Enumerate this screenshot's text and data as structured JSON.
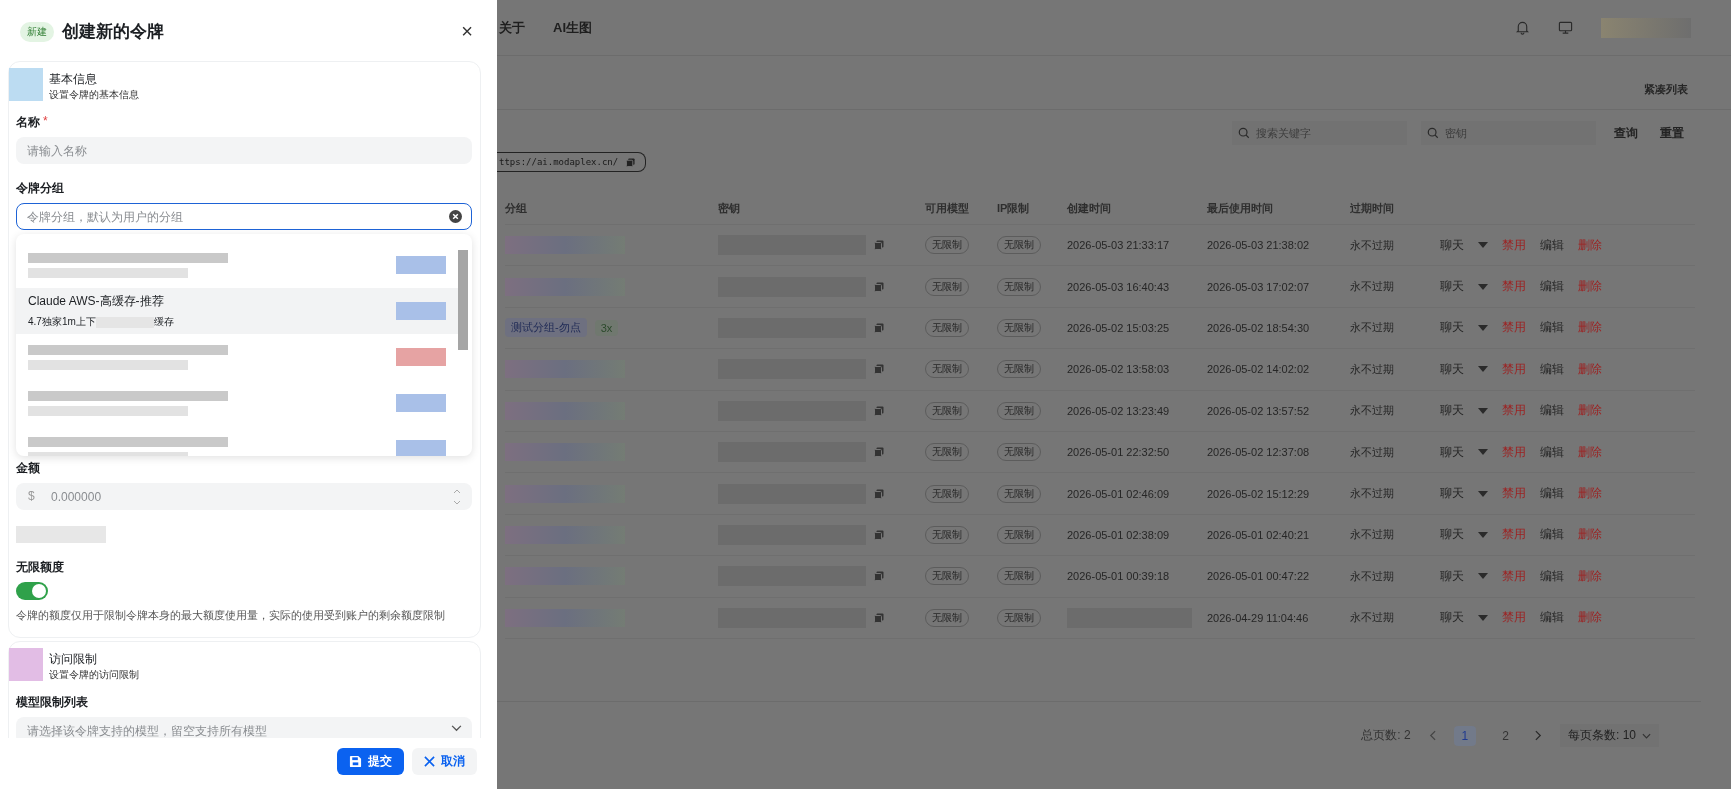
{
  "drawer": {
    "badge": "新建",
    "title": "创建新的令牌",
    "close": "×",
    "sections": [
      {
        "title": "基本信息",
        "subtitle": "设置令牌的基本信息",
        "color": "#bcdcf2"
      },
      {
        "title": "访问限制",
        "subtitle": "设置令牌的访问限制",
        "color": "#e2bde5"
      }
    ],
    "name_field": {
      "label": "名称",
      "required": "*",
      "placeholder": "请输入名称"
    },
    "group_field": {
      "label": "令牌分组",
      "placeholder": "令牌分组，默认为用户的分组",
      "focused": true
    },
    "group_options": [
      {
        "highlighted": false,
        "color": "#a9c0e8"
      },
      {
        "label": "Claude AWS-高缓存-推荐",
        "description_start": "4.7独家1m上下",
        "description_end": "缓存",
        "highlighted": true,
        "color": "#a9c0e8"
      },
      {
        "highlighted": false,
        "color": "#e6a3a3"
      },
      {
        "highlighted": false,
        "color": "#a9c0e8"
      },
      {
        "highlighted": false,
        "color": "#a9c0e8"
      }
    ],
    "amount_field": {
      "label": "金额",
      "prefix": "$",
      "placeholder": "0.000000"
    },
    "unlimited": {
      "label": "无限额度",
      "on": true,
      "help": "令牌的额度仅用于限制令牌本身的最大额度使用量，实际的使用受到账户的剩余额度限制"
    },
    "model_field": {
      "label": "模型限制列表",
      "placeholder": "请选择该令牌支持的模型，留空支持所有模型"
    },
    "buttons": [
      {
        "label": "提交",
        "kind": "primary"
      },
      {
        "label": "取消",
        "kind": "cancel"
      }
    ]
  },
  "page": {
    "nav": [
      "关于",
      "AI生图"
    ],
    "compact_toggle": "紧凑列表",
    "search": [
      {
        "placeholder": "搜索关键字"
      },
      {
        "placeholder": "密钥"
      }
    ],
    "actions": [
      "查询",
      "重置"
    ],
    "base_url": "ttps://ai.modaplex.cn/",
    "table": {
      "columns": [
        "分组",
        "密钥",
        "可用模型",
        "IP限制",
        "创建时间",
        "最后使用时间",
        "过期时间"
      ],
      "rows": [
        {
          "group": null,
          "models": "无限制",
          "ip": "无限制",
          "created": "2026-05-03 21:33:17",
          "last_used": "2026-05-03 21:38:02",
          "expires": "永不过期",
          "chat": "聊天",
          "disable": "禁用",
          "edit": "编辑",
          "delete": "删除"
        },
        {
          "group": null,
          "models": "无限制",
          "ip": "无限制",
          "created": "2026-05-03 16:40:43",
          "last_used": "2026-05-03 17:02:07",
          "expires": "永不过期",
          "chat": "聊天",
          "disable": "禁用",
          "edit": "编辑",
          "delete": "删除"
        },
        {
          "group": {
            "name": "测试分组-勿点",
            "ratio": "3x"
          },
          "models": "无限制",
          "ip": "无限制",
          "created": "2026-05-02 15:03:25",
          "last_used": "2026-05-02 18:54:30",
          "expires": "永不过期",
          "chat": "聊天",
          "disable": "禁用",
          "edit": "编辑",
          "delete": "删除"
        },
        {
          "group": null,
          "models": "无限制",
          "ip": "无限制",
          "created": "2026-05-02 13:58:03",
          "last_used": "2026-05-02 14:02:02",
          "expires": "永不过期",
          "chat": "聊天",
          "disable": "禁用",
          "edit": "编辑",
          "delete": "删除"
        },
        {
          "group": null,
          "models": "无限制",
          "ip": "无限制",
          "created": "2026-05-02 13:23:49",
          "last_used": "2026-05-02 13:57:52",
          "expires": "永不过期",
          "chat": "聊天",
          "disable": "禁用",
          "edit": "编辑",
          "delete": "删除"
        },
        {
          "group": null,
          "models": "无限制",
          "ip": "无限制",
          "created": "2026-05-01 22:32:50",
          "last_used": "2026-05-02 12:37:08",
          "expires": "永不过期",
          "chat": "聊天",
          "disable": "禁用",
          "edit": "编辑",
          "delete": "删除"
        },
        {
          "group": null,
          "models": "无限制",
          "ip": "无限制",
          "created": "2026-05-01 02:46:09",
          "last_used": "2026-05-02 15:12:29",
          "expires": "永不过期",
          "chat": "聊天",
          "disable": "禁用",
          "edit": "编辑",
          "delete": "删除"
        },
        {
          "group": null,
          "models": "无限制",
          "ip": "无限制",
          "created": "2026-05-01 02:38:09",
          "last_used": "2026-05-01 02:40:21",
          "expires": "永不过期",
          "chat": "聊天",
          "disable": "禁用",
          "edit": "编辑",
          "delete": "删除"
        },
        {
          "group": null,
          "models": "无限制",
          "ip": "无限制",
          "created": "2026-05-01 00:39:18",
          "last_used": "2026-05-01 00:47:22",
          "expires": "永不过期",
          "chat": "聊天",
          "disable": "禁用",
          "edit": "编辑",
          "delete": "删除"
        },
        {
          "group": null,
          "models": "无限制",
          "ip": "无限制",
          "created": null,
          "last_used": "2026-04-29 11:04:46",
          "expires": "永不过期",
          "chat": "聊天",
          "disable": "禁用",
          "edit": "编辑",
          "delete": "删除"
        }
      ]
    },
    "pagination": {
      "total_label": "总页数: 2",
      "pages": [
        {
          "label": "1",
          "selected": true
        },
        {
          "label": "2",
          "selected": false
        }
      ],
      "page_size": "每页条数: 10"
    }
  }
}
